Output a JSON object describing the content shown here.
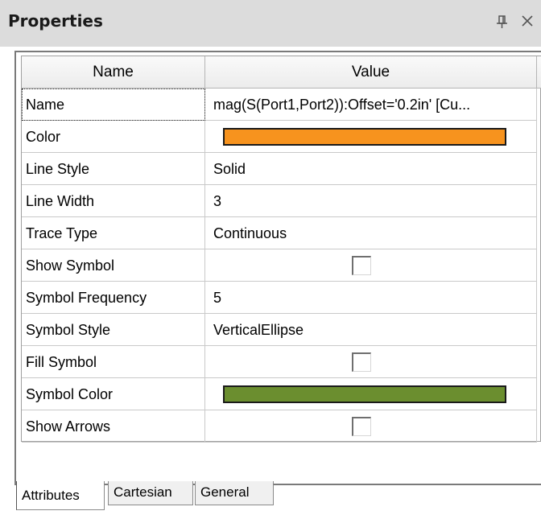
{
  "panel": {
    "title": "Properties"
  },
  "grid": {
    "headers": {
      "name": "Name",
      "value": "Value"
    },
    "rows": [
      {
        "name": "Name",
        "value": "mag(S(Port1,Port2)):Offset='0.2in' [Cu..."
      },
      {
        "name": "Color",
        "value": "",
        "color": "#f7931e"
      },
      {
        "name": "Line Style",
        "value": "Solid"
      },
      {
        "name": "Line Width",
        "value": "3"
      },
      {
        "name": "Trace Type",
        "value": "Continuous"
      },
      {
        "name": "Show Symbol",
        "value": "",
        "checked": false
      },
      {
        "name": "Symbol Frequency",
        "value": "5"
      },
      {
        "name": "Symbol Style",
        "value": "VerticalEllipse"
      },
      {
        "name": "Fill Symbol",
        "value": "",
        "checked": false
      },
      {
        "name": "Symbol Color",
        "value": "",
        "color": "#6b8e2f"
      },
      {
        "name": "Show Arrows",
        "value": "",
        "checked": false
      }
    ]
  },
  "tabs": [
    {
      "label": "Attributes",
      "active": true
    },
    {
      "label": "Cartesian",
      "active": false
    },
    {
      "label": "General",
      "active": false
    }
  ],
  "icons": {
    "pin": "pin-icon",
    "close": "close-icon"
  }
}
